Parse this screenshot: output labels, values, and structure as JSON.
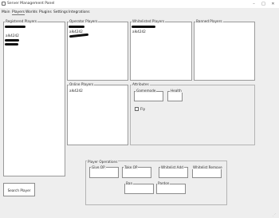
{
  "window": {
    "title": "Server Management Panel",
    "minimize": "–",
    "maximize": "□",
    "close": "✕",
    "icon": "app-icon"
  },
  "menu": [
    "Main",
    "Players",
    "Worlds",
    "Plugins",
    "Settings",
    "Integrations"
  ],
  "active_tab": "Players",
  "registered": {
    "label": "Registered Players",
    "items": [
      "alk4242"
    ]
  },
  "operators": {
    "label": "Operator Players",
    "items": [
      "alk4242"
    ]
  },
  "whitelisted": {
    "label": "Whitelisted Players",
    "items": [
      "alk4242"
    ]
  },
  "banned": {
    "label": "Banned Players",
    "items": []
  },
  "online": {
    "label": "Online Players",
    "items": [
      "alk4242"
    ]
  },
  "attributes": {
    "label": "Attributes",
    "gamemode": "Gamemode",
    "health": "Health",
    "fly": "Fly"
  },
  "operations": {
    "label": "Player Operations",
    "give_op": "Give OP",
    "take_op": "Take OP",
    "whitelist_add": "Whitelist Add",
    "whitelist_remove": "Whitelist Remove",
    "ban": "Ban",
    "pardon": "Pardon"
  },
  "search_button": "Search Player"
}
